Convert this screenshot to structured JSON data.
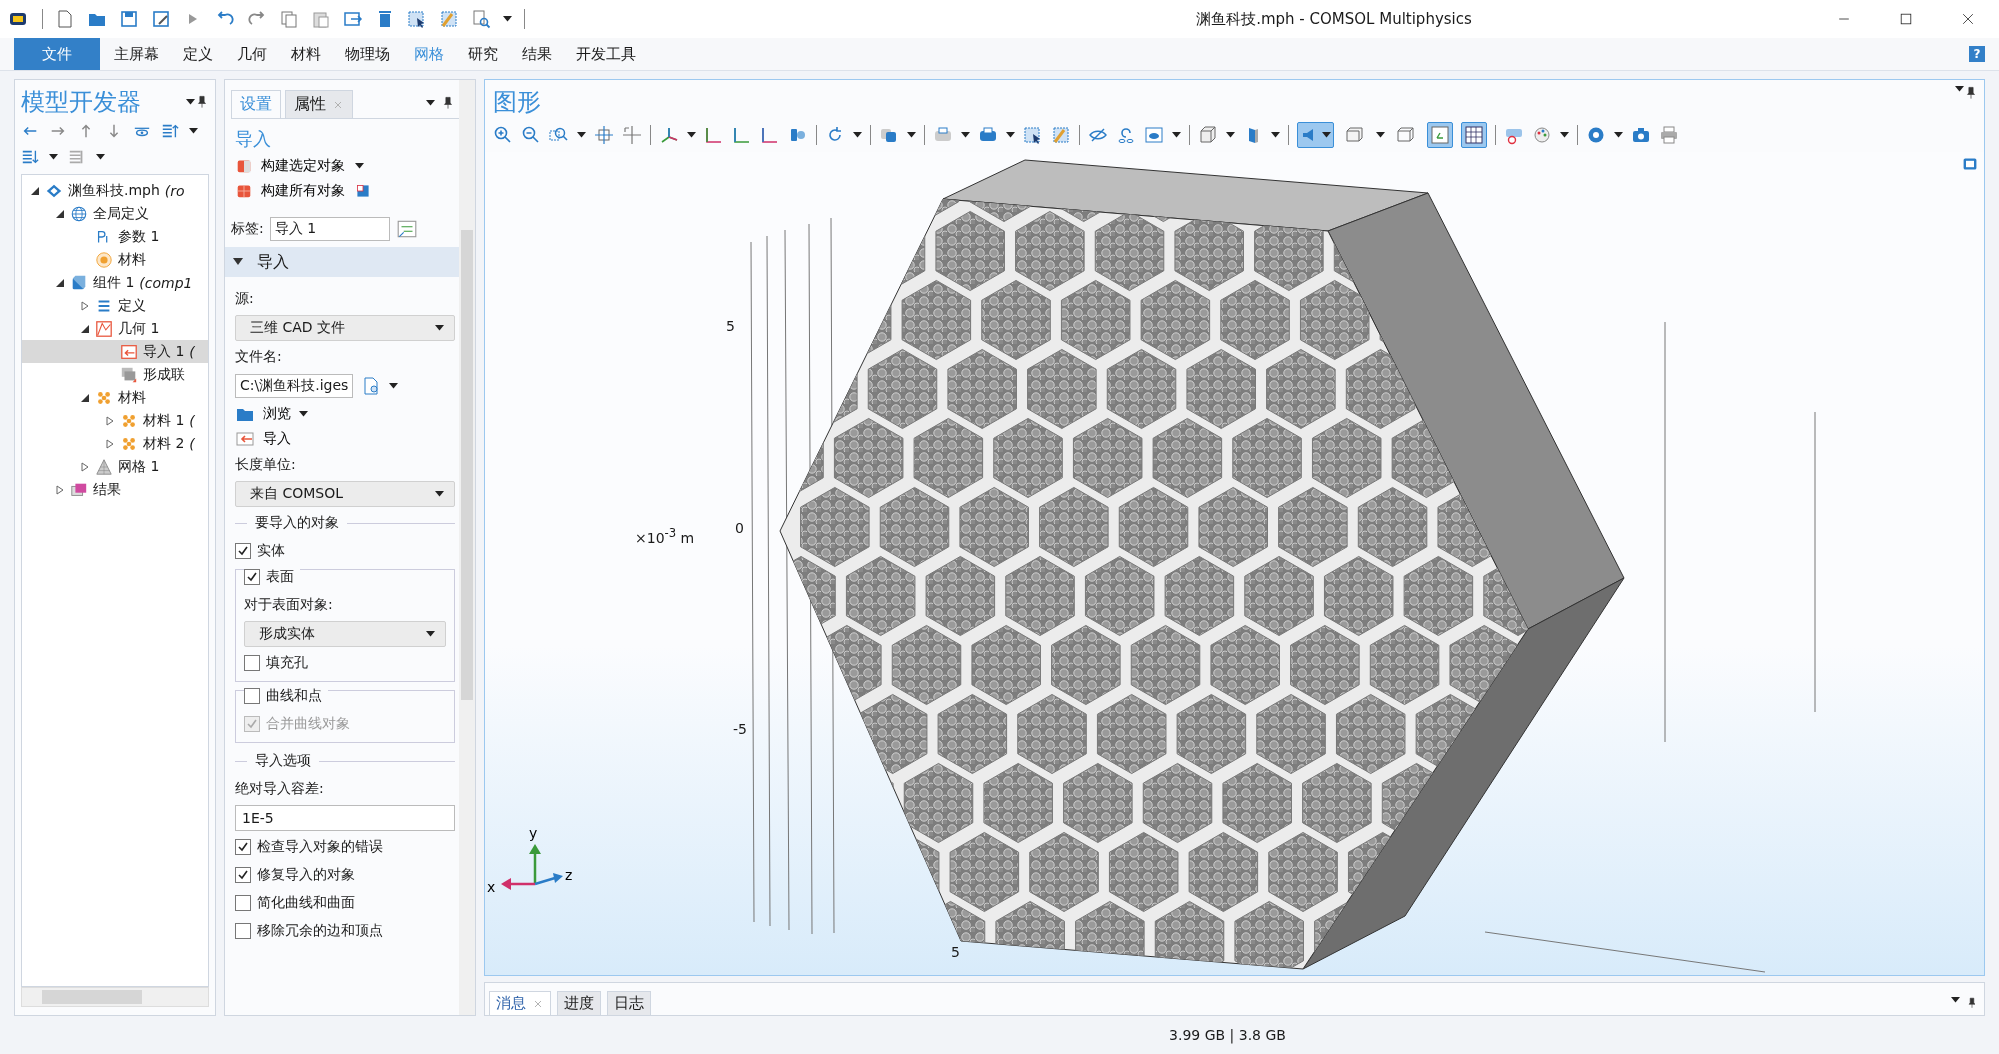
{
  "window": {
    "title": "渊鱼科技.mph - COMSOL Multiphysics"
  },
  "menu": [
    {
      "label": "文件",
      "kind": "file",
      "selected": false
    },
    {
      "label": "主屏幕",
      "kind": "tab",
      "selected": false
    },
    {
      "label": "定义",
      "kind": "tab",
      "selected": false
    },
    {
      "label": "几何",
      "kind": "tab",
      "selected": false
    },
    {
      "label": "材料",
      "kind": "tab",
      "selected": false
    },
    {
      "label": "物理场",
      "kind": "tab",
      "selected": false
    },
    {
      "label": "网格",
      "kind": "tab",
      "selected": true
    },
    {
      "label": "研究",
      "kind": "tab",
      "selected": false
    },
    {
      "label": "结果",
      "kind": "tab",
      "selected": false
    },
    {
      "label": "开发工具",
      "kind": "tab",
      "selected": false
    }
  ],
  "help": "?",
  "model_builder": {
    "title": "模型开发器",
    "tree": [
      {
        "label": "渊鱼科技.mph",
        "suffix": "(ro",
        "kind": "model",
        "expanded": true,
        "selected": false,
        "children": [
          {
            "label": "全局定义",
            "kind": "globe",
            "expanded": true,
            "selected": false,
            "children": [
              {
                "label": "参数 1",
                "kind": "param",
                "selected": false
              },
              {
                "label": "材料",
                "kind": "material_ball",
                "selected": false
              }
            ]
          },
          {
            "label": "组件 1",
            "suffix": "(comp1",
            "kind": "component",
            "expanded": true,
            "selected": false,
            "children": [
              {
                "label": "定义",
                "kind": "definitions",
                "expanded": false,
                "selected": false
              },
              {
                "label": "几何 1",
                "kind": "geometry",
                "expanded": true,
                "selected": false,
                "children": [
                  {
                    "label": "导入 1",
                    "suffix": "(",
                    "kind": "import",
                    "selected": true
                  },
                  {
                    "label": "形成联",
                    "kind": "union",
                    "selected": false
                  }
                ]
              },
              {
                "label": "材料",
                "kind": "materials",
                "expanded": true,
                "selected": false,
                "children": [
                  {
                    "label": "材料 1",
                    "suffix": "(",
                    "kind": "materials",
                    "expanded": false,
                    "selected": false
                  },
                  {
                    "label": "材料 2",
                    "suffix": "(",
                    "kind": "materials",
                    "expanded": false,
                    "selected": false
                  }
                ]
              },
              {
                "label": "网格 1",
                "kind": "mesh",
                "expanded": false,
                "selected": false
              }
            ]
          },
          {
            "label": "结果",
            "kind": "results",
            "expanded": false,
            "selected": false
          }
        ]
      }
    ]
  },
  "settings": {
    "tabs": [
      {
        "label": "设置",
        "selected": true,
        "closable": false
      },
      {
        "label": "属性",
        "selected": false,
        "closable": true
      }
    ],
    "heading": "导入",
    "actions": [
      {
        "label": "构建选定对象",
        "kind": "build_selected"
      },
      {
        "label": "构建所有对象",
        "kind": "build_all"
      }
    ],
    "label_field": {
      "label": "标签:",
      "value": "导入 1"
    },
    "section": {
      "title": "导入",
      "expanded": true
    },
    "form": [
      {
        "kind": "label",
        "text": "源:"
      },
      {
        "kind": "dropdown",
        "value": "三维 CAD 文件"
      },
      {
        "kind": "label",
        "text": "文件名:"
      },
      {
        "kind": "file",
        "value": "C:\\渊鱼科技.iges"
      },
      {
        "kind": "browse",
        "text": "浏览"
      },
      {
        "kind": "import",
        "text": "导入"
      },
      {
        "kind": "label",
        "text": "长度单位:"
      },
      {
        "kind": "dropdown",
        "value": "来自 COMSOL"
      },
      {
        "kind": "heading",
        "text": "要导入的对象"
      },
      {
        "kind": "checkbox",
        "text": "实体",
        "checked": true,
        "disabled": false
      },
      {
        "kind": "group",
        "text": "表面",
        "checked": true,
        "items": [
          {
            "kind": "label",
            "text": "对于表面对象:"
          },
          {
            "kind": "dropdown",
            "value": "形成实体"
          },
          {
            "kind": "checkbox",
            "text": "填充孔",
            "checked": false,
            "disabled": false
          }
        ]
      },
      {
        "kind": "group",
        "text": "曲线和点",
        "checked": false,
        "items": [
          {
            "kind": "checkbox",
            "text": "合并曲线对象",
            "checked": true,
            "disabled": true
          }
        ]
      },
      {
        "kind": "heading",
        "text": "导入选项"
      },
      {
        "kind": "label",
        "text": "绝对导入容差:"
      },
      {
        "kind": "input",
        "value": "1E-5"
      },
      {
        "kind": "checkbox",
        "text": "检查导入对象的错误",
        "checked": true,
        "disabled": false
      },
      {
        "kind": "checkbox",
        "text": "修复导入的对象",
        "checked": true,
        "disabled": false
      },
      {
        "kind": "checkbox",
        "text": "简化曲线和曲面",
        "checked": false,
        "disabled": false
      },
      {
        "kind": "checkbox",
        "text": "移除冗余的边和顶点",
        "checked": false,
        "disabled": false
      }
    ]
  },
  "graphics": {
    "title": "图形",
    "toolbar_toggles": [
      {
        "on": true
      },
      {
        "on": false
      },
      {
        "on": false
      },
      {
        "on": true
      },
      {
        "on": true
      }
    ],
    "axis_labels": [
      {
        "text": "5"
      },
      {
        "text": "0"
      },
      {
        "text": "-5"
      },
      {
        "text": "×10$^{-3}$ m"
      },
      {
        "text": "5"
      }
    ],
    "triad": [
      "x",
      "y",
      "z"
    ]
  },
  "messages": {
    "tabs": [
      {
        "label": "消息",
        "selected": true,
        "closable": true
      },
      {
        "label": "进度",
        "selected": false,
        "closable": false
      },
      {
        "label": "日志",
        "selected": false,
        "closable": false
      }
    ]
  },
  "status_bar": {
    "memory": "3.99 GB | 3.8 GB"
  }
}
